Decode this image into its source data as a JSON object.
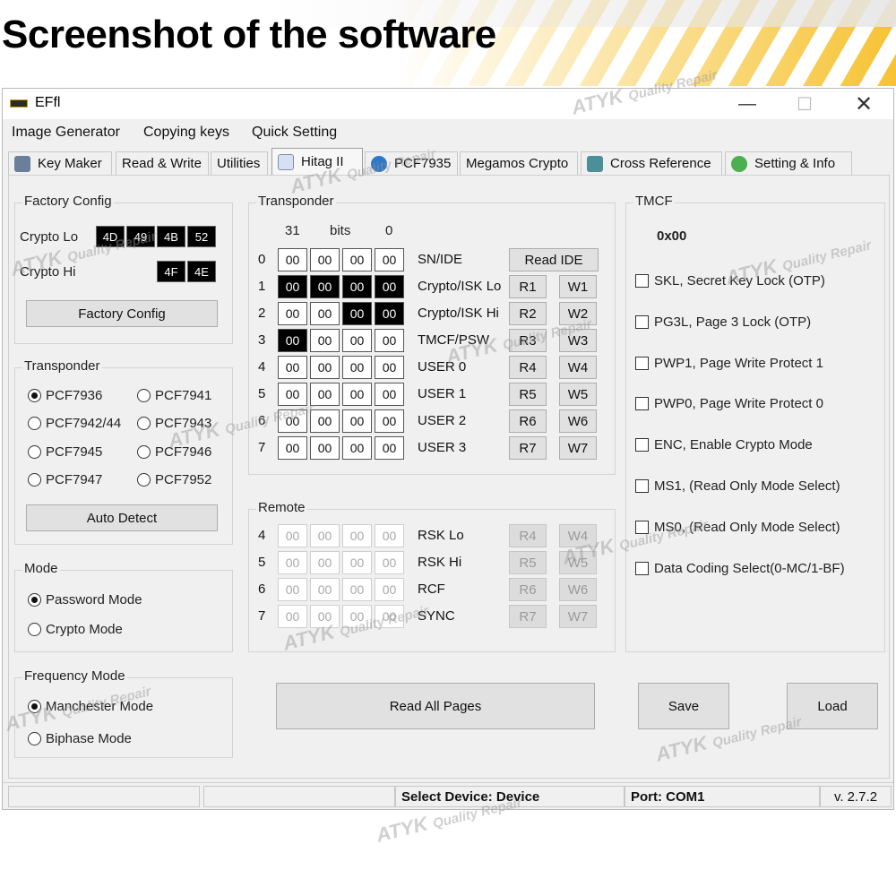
{
  "banner": {
    "title": "Screenshot of the software"
  },
  "window": {
    "title": "EFfl",
    "controls": {
      "minimize": "—",
      "maximize": "☐",
      "close": "✕"
    }
  },
  "menu": [
    "Image Generator",
    "Copying keys",
    "Quick Setting"
  ],
  "tabs": [
    {
      "label": "Key Maker",
      "icon": "key-icon"
    },
    {
      "label": "Read & Write"
    },
    {
      "label": "Utilities"
    },
    {
      "label": "Hitag II",
      "icon": "chip-icon",
      "active": true
    },
    {
      "label": "PCF7935",
      "icon": "globe-icon"
    },
    {
      "label": "Megamos Crypto"
    },
    {
      "label": "Cross Reference",
      "icon": "tools-icon"
    },
    {
      "label": "Setting & Info",
      "icon": "gear-icon"
    }
  ],
  "factory_config": {
    "title": "Factory Config",
    "crypto_lo_label": "Crypto Lo",
    "crypto_lo": [
      "4D",
      "49",
      "4B",
      "52"
    ],
    "crypto_hi_label": "Crypto Hi",
    "crypto_hi": [
      "4F",
      "4E"
    ],
    "button": "Factory Config"
  },
  "transponder_select": {
    "title": "Transponder",
    "options": [
      "PCF7936",
      "PCF7941",
      "PCF7942/44",
      "PCF7943",
      "PCF7945",
      "PCF7946",
      "PCF7947",
      "PCF7952"
    ],
    "selected": "PCF7936",
    "button": "Auto Detect"
  },
  "mode": {
    "title": "Mode",
    "options": [
      "Password Mode",
      "Crypto Mode"
    ],
    "selected": "Password Mode"
  },
  "frequency_mode": {
    "title": "Frequency Mode",
    "options": [
      "Manchester Mode",
      "Biphase Mode"
    ],
    "selected": "Manchester Mode"
  },
  "transponder_pages": {
    "title": "Transponder",
    "header": {
      "left": "31",
      "mid": "bits",
      "right": "0"
    },
    "rows": [
      {
        "num": "0",
        "cells": [
          "00",
          "00",
          "00",
          "00"
        ],
        "dark": [
          false,
          false,
          false,
          false
        ],
        "label": "SN/IDE",
        "buttons": [
          "Read IDE"
        ]
      },
      {
        "num": "1",
        "cells": [
          "00",
          "00",
          "00",
          "00"
        ],
        "dark": [
          true,
          true,
          true,
          true
        ],
        "label": "Crypto/ISK Lo",
        "buttons": [
          "R1",
          "W1"
        ]
      },
      {
        "num": "2",
        "cells": [
          "00",
          "00",
          "00",
          "00"
        ],
        "dark": [
          false,
          false,
          true,
          true
        ],
        "label": "Crypto/ISK Hi",
        "buttons": [
          "R2",
          "W2"
        ]
      },
      {
        "num": "3",
        "cells": [
          "00",
          "00",
          "00",
          "00"
        ],
        "dark": [
          true,
          false,
          false,
          false
        ],
        "label": "TMCF/PSW",
        "buttons": [
          "R3",
          "W3"
        ]
      },
      {
        "num": "4",
        "cells": [
          "00",
          "00",
          "00",
          "00"
        ],
        "dark": [
          false,
          false,
          false,
          false
        ],
        "label": "USER 0",
        "buttons": [
          "R4",
          "W4"
        ]
      },
      {
        "num": "5",
        "cells": [
          "00",
          "00",
          "00",
          "00"
        ],
        "dark": [
          false,
          false,
          false,
          false
        ],
        "label": "USER 1",
        "buttons": [
          "R5",
          "W5"
        ]
      },
      {
        "num": "6",
        "cells": [
          "00",
          "00",
          "00",
          "00"
        ],
        "dark": [
          false,
          false,
          false,
          false
        ],
        "label": "USER 2",
        "buttons": [
          "R6",
          "W6"
        ]
      },
      {
        "num": "7",
        "cells": [
          "00",
          "00",
          "00",
          "00"
        ],
        "dark": [
          false,
          false,
          false,
          false
        ],
        "label": "USER 3",
        "buttons": [
          "R7",
          "W7"
        ]
      }
    ]
  },
  "remote": {
    "title": "Remote",
    "rows": [
      {
        "num": "4",
        "cells": [
          "00",
          "00",
          "00",
          "00"
        ],
        "label": "RSK Lo",
        "buttons": [
          "R4",
          "W4"
        ]
      },
      {
        "num": "5",
        "cells": [
          "00",
          "00",
          "00",
          "00"
        ],
        "label": "RSK Hi",
        "buttons": [
          "R5",
          "W5"
        ]
      },
      {
        "num": "6",
        "cells": [
          "00",
          "00",
          "00",
          "00"
        ],
        "label": "RCF",
        "buttons": [
          "R6",
          "W6"
        ]
      },
      {
        "num": "7",
        "cells": [
          "00",
          "00",
          "00",
          "00"
        ],
        "label": "SYNC",
        "buttons": [
          "R7",
          "W7"
        ]
      }
    ]
  },
  "tmcf": {
    "title": "TMCF",
    "value": "0x00",
    "options": [
      "SKL, Secret Key Lock (OTP)",
      "PG3L, Page 3 Lock (OTP)",
      "PWP1, Page Write Protect 1",
      "PWP0, Page Write Protect 0",
      "ENC, Enable Crypto Mode",
      "MS1, (Read Only Mode Select)",
      "MS0, (Read Only Mode Select)",
      "Data Coding Select(0-MC/1-BF)"
    ]
  },
  "actions": {
    "read_all": "Read All Pages",
    "save": "Save",
    "load": "Load"
  },
  "status": {
    "device": "Select Device: Device",
    "port": "Port:  COM1",
    "version": "v. 2.7.2"
  },
  "watermark": {
    "brand": "ATYK",
    "tagline": "Quality Repair"
  },
  "colors": {
    "accent_yellow": "#f4b400",
    "window_bg": "#f0f0f0",
    "dark_cell": "#000000"
  }
}
